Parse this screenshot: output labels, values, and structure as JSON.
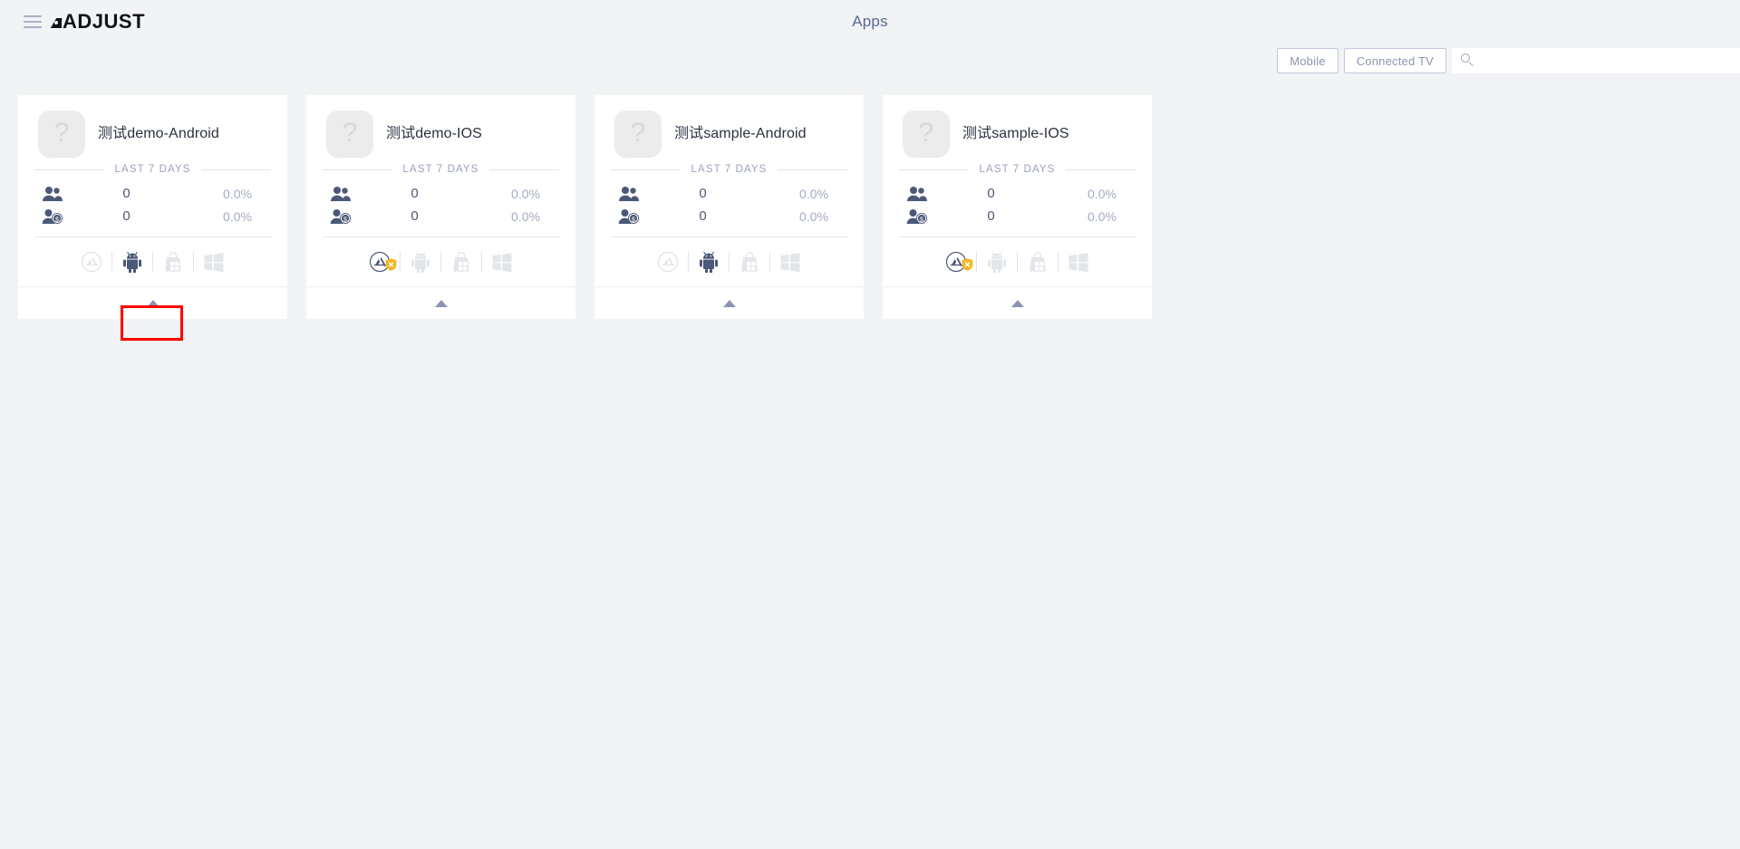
{
  "header": {
    "menu_icon": "hamburger-menu-icon",
    "brand": "ADJUST",
    "title": "Apps"
  },
  "toolbar": {
    "filters": [
      {
        "label": "Mobile",
        "active": false
      },
      {
        "label": "Connected TV",
        "active": false
      }
    ],
    "search": {
      "icon": "search-icon",
      "value": "",
      "placeholder": ""
    }
  },
  "colors": {
    "page_background": "#f1f3f5",
    "card_background": "#ffffff",
    "text_primary": "#2c3142",
    "text_muted": "#9aa2bb",
    "accent_icon": "#4b5878",
    "warning_badge": "#f2b824",
    "highlight": "#ff0000"
  },
  "period_label": "LAST 7 DAYS",
  "stat_labels": {
    "users": "users-icon",
    "paying_users": "user-dollar-icon"
  },
  "cards": [
    {
      "app_icon": "app-placeholder-icon",
      "app_icon_glyph": "?",
      "name": "测试demo-Android",
      "period": "LAST 7 DAYS",
      "stats": [
        {
          "icon": "users-icon",
          "value": "0",
          "percent": "0.0%"
        },
        {
          "icon": "user-dollar-icon",
          "value": "0",
          "percent": "0.0%"
        }
      ],
      "platforms": [
        {
          "icon": "app-store-icon",
          "name": "app-store",
          "active": false,
          "badge": null
        },
        {
          "icon": "android-icon",
          "name": "android",
          "active": true,
          "badge": null
        },
        {
          "icon": "windows-store-icon",
          "name": "windows-store",
          "active": false,
          "badge": null
        },
        {
          "icon": "windows-icon",
          "name": "windows",
          "active": false,
          "badge": null
        }
      ],
      "collapse_icon": "caret-up-icon",
      "highlighted": true
    },
    {
      "app_icon": "app-placeholder-icon",
      "app_icon_glyph": "?",
      "name": "测试demo-IOS",
      "period": "LAST 7 DAYS",
      "stats": [
        {
          "icon": "users-icon",
          "value": "0",
          "percent": "0.0%"
        },
        {
          "icon": "user-dollar-icon",
          "value": "0",
          "percent": "0.0%"
        }
      ],
      "platforms": [
        {
          "icon": "app-store-icon",
          "name": "app-store",
          "active": true,
          "badge": "warning-shield-icon"
        },
        {
          "icon": "android-icon",
          "name": "android",
          "active": false,
          "badge": null
        },
        {
          "icon": "windows-store-icon",
          "name": "windows-store",
          "active": false,
          "badge": null
        },
        {
          "icon": "windows-icon",
          "name": "windows",
          "active": false,
          "badge": null
        }
      ],
      "collapse_icon": "caret-up-icon",
      "highlighted": false
    },
    {
      "app_icon": "app-placeholder-icon",
      "app_icon_glyph": "?",
      "name": "测试sample-Android",
      "period": "LAST 7 DAYS",
      "stats": [
        {
          "icon": "users-icon",
          "value": "0",
          "percent": "0.0%"
        },
        {
          "icon": "user-dollar-icon",
          "value": "0",
          "percent": "0.0%"
        }
      ],
      "platforms": [
        {
          "icon": "app-store-icon",
          "name": "app-store",
          "active": false,
          "badge": null
        },
        {
          "icon": "android-icon",
          "name": "android",
          "active": true,
          "badge": null
        },
        {
          "icon": "windows-store-icon",
          "name": "windows-store",
          "active": false,
          "badge": null
        },
        {
          "icon": "windows-icon",
          "name": "windows",
          "active": false,
          "badge": null
        }
      ],
      "collapse_icon": "caret-up-icon",
      "highlighted": false
    },
    {
      "app_icon": "app-placeholder-icon",
      "app_icon_glyph": "?",
      "name": "测试sample-IOS",
      "period": "LAST 7 DAYS",
      "stats": [
        {
          "icon": "users-icon",
          "value": "0",
          "percent": "0.0%"
        },
        {
          "icon": "user-dollar-icon",
          "value": "0",
          "percent": "0.0%"
        }
      ],
      "platforms": [
        {
          "icon": "app-store-icon",
          "name": "app-store",
          "active": true,
          "badge": "warning-shield-icon"
        },
        {
          "icon": "android-icon",
          "name": "android",
          "active": false,
          "badge": null
        },
        {
          "icon": "windows-store-icon",
          "name": "windows-store",
          "active": false,
          "badge": null
        },
        {
          "icon": "windows-icon",
          "name": "windows",
          "active": false,
          "badge": null
        }
      ],
      "collapse_icon": "caret-up-icon",
      "highlighted": false
    }
  ]
}
